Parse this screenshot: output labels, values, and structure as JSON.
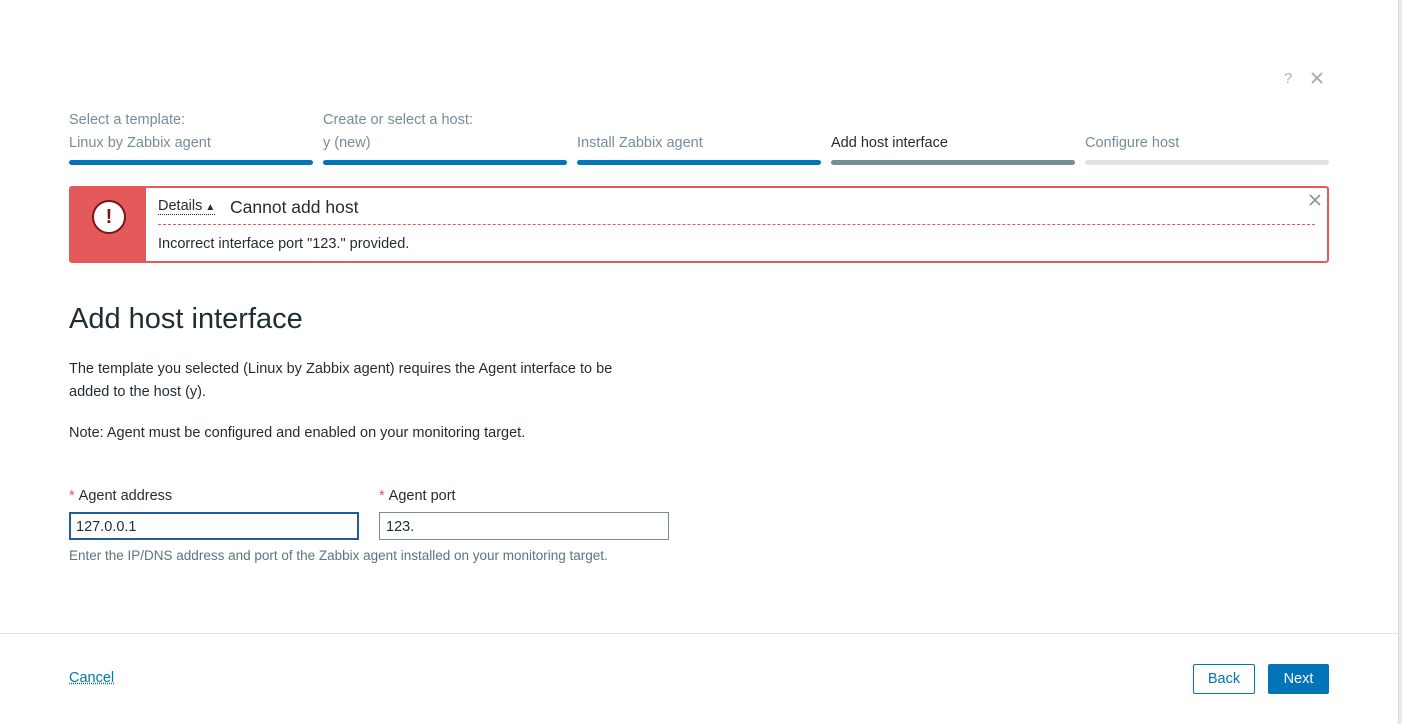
{
  "header": {
    "help_glyph": "?",
    "icons": [
      "help-icon",
      "close-icon"
    ]
  },
  "steps": [
    {
      "subtitle": "Select a template:",
      "value": "Linux by Zabbix agent",
      "state": "done"
    },
    {
      "subtitle": "Create or select a host:",
      "value": "y (new)",
      "state": "done"
    },
    {
      "subtitle": "",
      "value": "Install Zabbix agent",
      "state": "done"
    },
    {
      "subtitle": "",
      "value": "Add host interface",
      "state": "current"
    },
    {
      "subtitle": "",
      "value": "Configure host",
      "state": "todo"
    }
  ],
  "alert": {
    "details_label": "Details",
    "caret": "▲",
    "icon_glyph": "!",
    "title": "Cannot add host",
    "message": "Incorrect interface port \"123.\" provided.",
    "color": "#e45959"
  },
  "main": {
    "title": "Add host interface",
    "description": "The template you selected (Linux by Zabbix agent) requires the Agent interface to be added to the host (y).",
    "note": "Note: Agent must be configured and enabled on your monitoring target.",
    "required_mark": "*",
    "address_label": "Agent address",
    "address_value": "127.0.0.1",
    "port_label": "Agent port",
    "port_value": "123.",
    "hint": "Enter the IP/DNS address and port of the Zabbix agent installed on your monitoring target."
  },
  "footer": {
    "cancel_label": "Cancel",
    "back_label": "Back",
    "next_label": "Next"
  },
  "colors": {
    "accent": "#0275b8",
    "error": "#e45959",
    "muted": "#768d99"
  }
}
